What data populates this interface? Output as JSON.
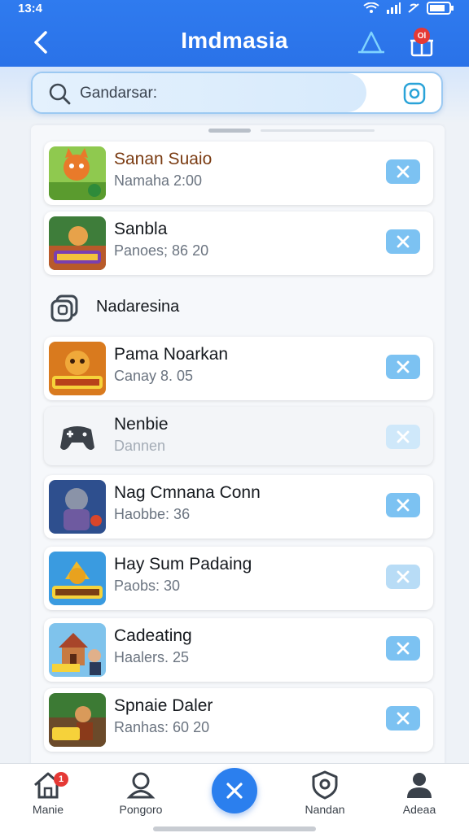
{
  "status_bar": {
    "time": "13:4"
  },
  "header": {
    "title": "Imdmasia"
  },
  "badges": {
    "gift": "Ol"
  },
  "search": {
    "placeholder": "Gandarsar:"
  },
  "section": {
    "label": "Nadaresina"
  },
  "items": [
    {
      "title": "Sanan Suaio",
      "subtitle": "Namaha 2:00"
    },
    {
      "title": "Sanbla",
      "subtitle": "Panoes; 86 20"
    },
    {
      "title": "Pama Noarkan",
      "subtitle": "Canay 8. 05"
    },
    {
      "title": "Nenbie",
      "subtitle": "Dannen"
    },
    {
      "title": "Nag Cmnana Conn",
      "subtitle": "Haobbe: 36"
    },
    {
      "title": "Hay Sum Padaing",
      "subtitle": "Paobs: 30"
    },
    {
      "title": "Cadeating",
      "subtitle": "Haalers. 25"
    },
    {
      "title": "Spnaie Daler",
      "subtitle": "Ranhas: 60 20"
    }
  ],
  "nav": {
    "home": "Manie",
    "profile": "Pongoro",
    "shield": "Nandan",
    "account": "Adeaa",
    "home_badge": "1"
  },
  "colors": {
    "primary": "#2b7fee",
    "accent_button": "#7cc2f2"
  }
}
